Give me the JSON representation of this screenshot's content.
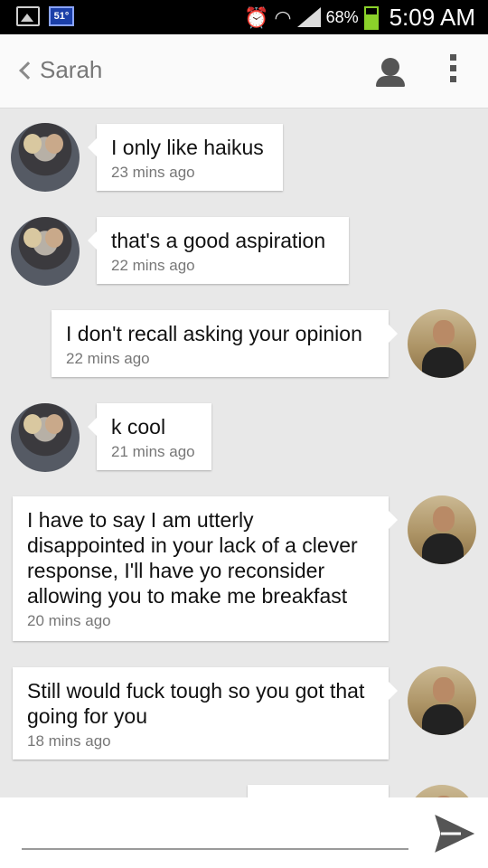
{
  "status_bar": {
    "temperature": "51°",
    "battery_percent": "68%",
    "time": "5:09 AM",
    "icons": [
      "gallery-icon",
      "weather-icon",
      "alarm-icon",
      "wifi-icon",
      "signal-icon",
      "battery-icon"
    ]
  },
  "header": {
    "title": "Sarah",
    "icons": [
      "back-chevron-icon",
      "person-icon",
      "overflow-menu-icon"
    ]
  },
  "messages": [
    {
      "from": "Sarah",
      "text": "I only like haikus",
      "time": "23 mins ago"
    },
    {
      "from": "Sarah",
      "text": "that's a good aspiration",
      "time": "22 mins ago"
    },
    {
      "from": "me",
      "text": "I don't recall asking your opinion",
      "time": "22 mins ago"
    },
    {
      "from": "Sarah",
      "text": "k cool",
      "time": "21 mins ago"
    },
    {
      "from": "me",
      "text": "I have to say I am utterly disappointed in your lack of a clever response, I'll have yo reconsider allowing you to make me breakfast",
      "time": "20 mins ago"
    },
    {
      "from": "me",
      "text": "Still would fuck tough so you got that going for you",
      "time": "18 mins ago"
    }
  ],
  "composer": {
    "value": "",
    "send_icon": "send-arrow-icon"
  }
}
